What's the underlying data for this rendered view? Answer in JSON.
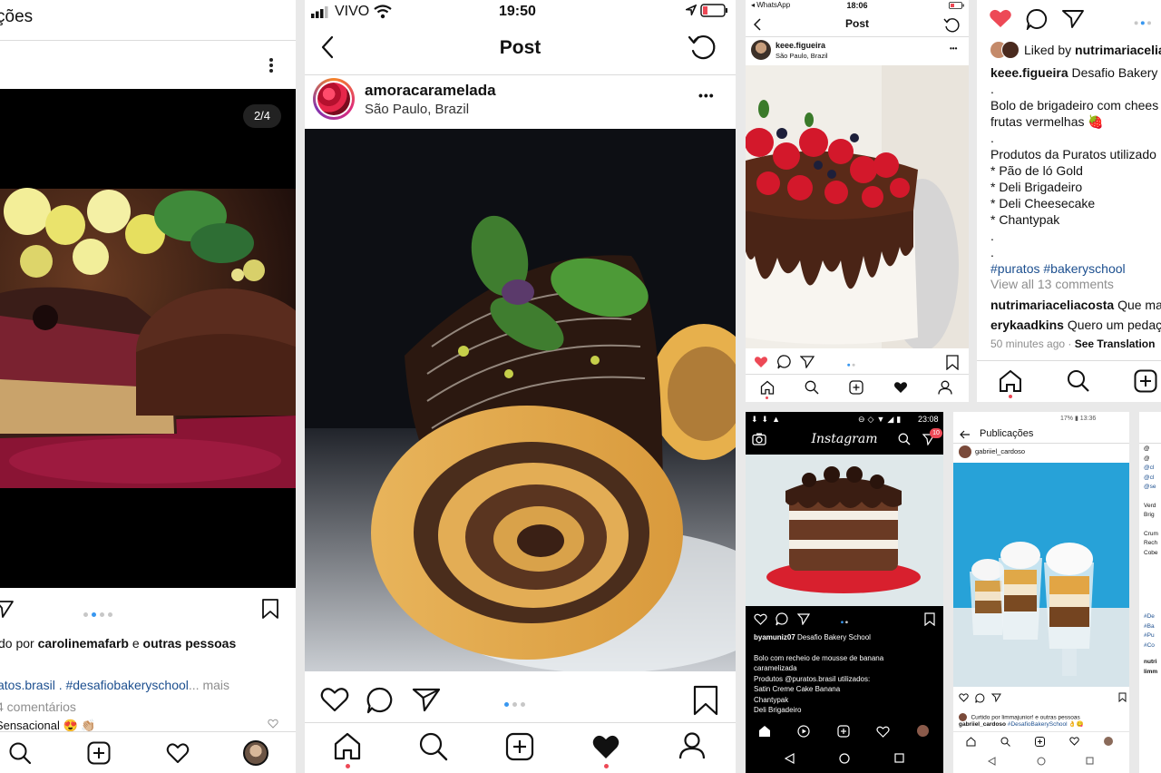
{
  "colors": {
    "like": "#ed4956",
    "blue": "#3897f0",
    "hashtag": "#1c4f8f",
    "gray": "#8e8e8e"
  },
  "p1": {
    "header_title": "ções",
    "counter": "2/4",
    "liked_prefix": "do por",
    "liked_user": "carolinemafarb",
    "liked_e": "e",
    "liked_rest": "outras pessoas",
    "caption_tags": "atos.brasil . #desafiobakeryschool",
    "caption_more": "... mais",
    "comments": "4 comentários",
    "last_comment": "Sensacional 😍 👏🏼"
  },
  "p2": {
    "carrier": "VIVO",
    "time": "19:50",
    "header_title": "Post",
    "username": "amoracaramelada",
    "location": "São Paulo, Brazil",
    "more": "•••"
  },
  "p3": {
    "status_left": "◂ WhatsApp",
    "time": "18:06",
    "header_title": "Post",
    "username": "keee.figueira",
    "location": "São Paulo, Brazil",
    "more": "•••"
  },
  "p4": {
    "liked_label": "Liked by",
    "liked_user": "nutrimariacelia",
    "caption_user": "keee.figueira",
    "caption_text": "Desafio Bakery",
    "line_dot1": ".",
    "line_recipe": "Bolo de brigadeiro com chees",
    "line_recipe2": "frutas vermelhas 🍓",
    "line_dot2": ".",
    "line_products": "Produtos da Puratos utilizado",
    "items": [
      "* Pão de ló Gold",
      "* Deli Brigadeiro",
      "* Deli Cheesecake",
      "* Chantypak"
    ],
    "line_dot3": ".",
    "line_dot4": ".",
    "hashtags": "#puratos #bakeryschool",
    "view_all": "View all 13 comments",
    "c1_user": "nutrimariaceliacosta",
    "c1_text": "Que ma",
    "c2_user": "erykaadkins",
    "c2_text": "Quero um pedaç",
    "time": "50 minutes ago",
    "see_translation": "See Translation"
  },
  "p5": {
    "time": "23:08",
    "brand": "Instagram",
    "badge": "10",
    "username": "byamuniz07",
    "caption_title": "Desafio Bakery School",
    "lines": [
      "Bolo com recheio de mousse de banana",
      "caramelizada",
      "Produtos @puratos.brasil utilizados:",
      "Satin Creme Cake Banana",
      "Chantypak",
      "Deli Brigadeiro"
    ]
  },
  "p6": {
    "status_right": "17% ▮ 13:36",
    "header_title": "Publicações",
    "username": "gabriiel_cardoso",
    "liked": "Curtido por limmajunior! e outras pessoas",
    "caption_user": "gabriiel_cardoso",
    "caption_tag": "#DesafioBakerySchool 👌😋"
  },
  "p7": {
    "frag": [
      "@",
      "@",
      "@cl",
      "@cl",
      "@se",
      "Verd",
      "Brig",
      "Crum",
      "Rech",
      "Cobe",
      "#De",
      "#Ba",
      "#Pu",
      "#Co",
      "nutri",
      "limm"
    ]
  }
}
